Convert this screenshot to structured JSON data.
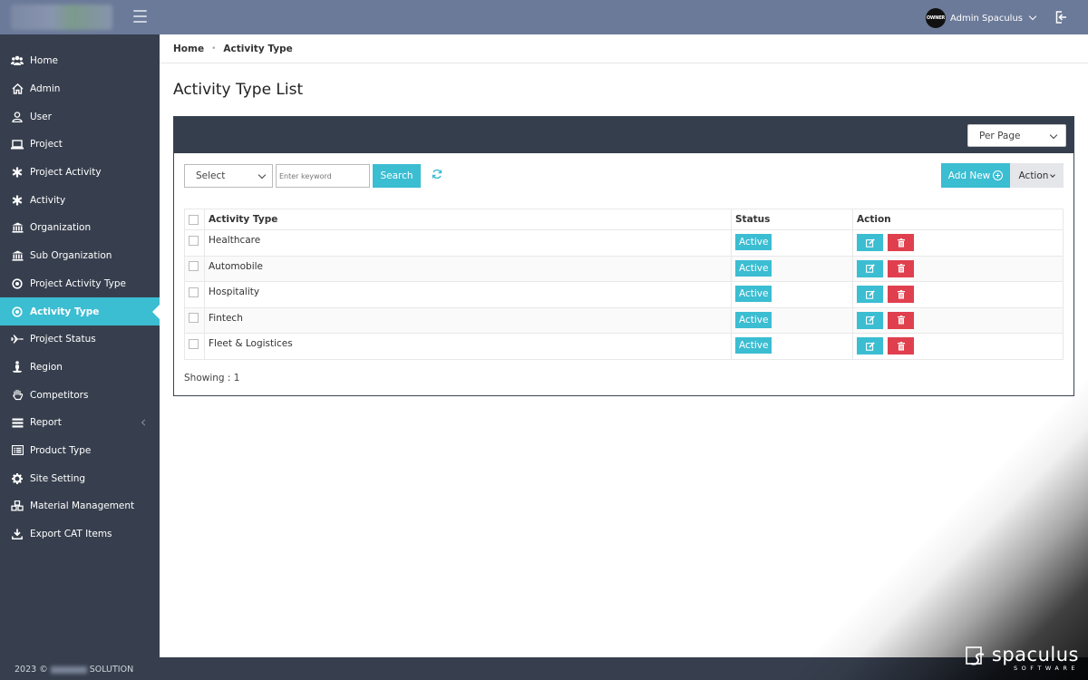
{
  "header": {
    "user_name": "Admin Spaculus",
    "avatar_text": "OWNER"
  },
  "sidebar": {
    "items": [
      {
        "label": "Home",
        "icon": "users-icon"
      },
      {
        "label": "Admin",
        "icon": "home-icon"
      },
      {
        "label": "User",
        "icon": "user-icon"
      },
      {
        "label": "Project",
        "icon": "laptop-icon"
      },
      {
        "label": "Project Activity",
        "icon": "asterisk-icon"
      },
      {
        "label": "Activity",
        "icon": "asterisk-icon"
      },
      {
        "label": "Organization",
        "icon": "bank-icon"
      },
      {
        "label": "Sub Organization",
        "icon": "bank-icon"
      },
      {
        "label": "Project Activity Type",
        "icon": "dot-circle-icon"
      },
      {
        "label": "Activity Type",
        "icon": "dot-circle-icon"
      },
      {
        "label": "Project Status",
        "icon": "plane-icon"
      },
      {
        "label": "Region",
        "icon": "street-view-icon"
      },
      {
        "label": "Competitors",
        "icon": "hand-icon"
      },
      {
        "label": "Report",
        "icon": "list-icon"
      },
      {
        "label": "Product Type",
        "icon": "list-alt-icon"
      },
      {
        "label": "Site Setting",
        "icon": "gear-icon"
      },
      {
        "label": "Material Management",
        "icon": "cubes-icon"
      },
      {
        "label": "Export CAT Items",
        "icon": "download-icon"
      }
    ],
    "active_label": "Activity Type",
    "copyright_prefix": "2023 ©",
    "copyright_suffix": "SOLUTION"
  },
  "breadcrumb": {
    "home": "Home",
    "current": "Activity Type"
  },
  "page": {
    "title": "Activity Type List"
  },
  "panel": {
    "per_page_label": "Per Page",
    "filter_select": "Select",
    "keyword_placeholder": "Enter keyword",
    "search_label": "Search",
    "add_new_label": "Add New",
    "action_label": "Action",
    "showing_text": "Showing : 1"
  },
  "table": {
    "headers": {
      "activity_type": "Activity Type",
      "status": "Status",
      "action": "Action"
    },
    "rows": [
      {
        "activity_type": "Healthcare",
        "status": "Active"
      },
      {
        "activity_type": "Automobile",
        "status": "Active"
      },
      {
        "activity_type": "Hospitality",
        "status": "Active"
      },
      {
        "activity_type": "Fintech",
        "status": "Active"
      },
      {
        "activity_type": "Fleet & Logistices",
        "status": "Active"
      }
    ]
  },
  "watermark": {
    "brand_name": "spaculus",
    "brand_sub": "SOFTWARE"
  },
  "colors": {
    "topbar": "#6b7a99",
    "sidebar": "#373f4e",
    "accent": "#3bbdd2",
    "danger": "#e0404e",
    "panel_header": "#353e4c"
  }
}
